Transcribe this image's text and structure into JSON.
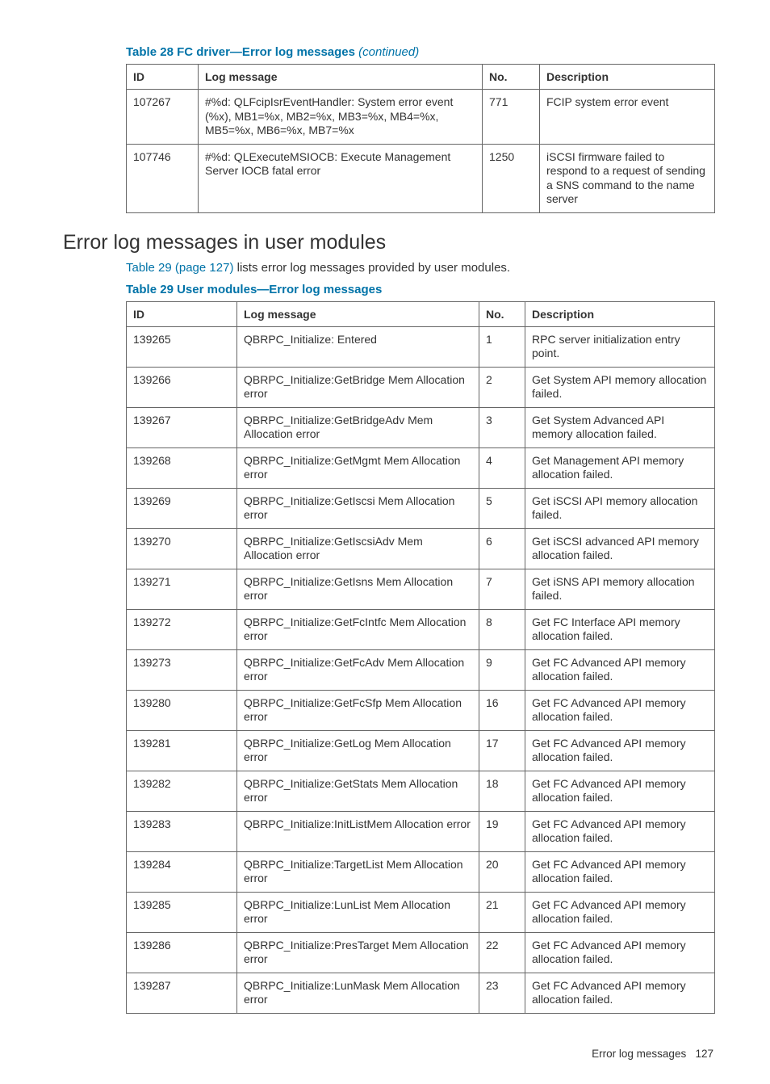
{
  "table28": {
    "caption_prefix": "Table 28 FC driver—Error log messages",
    "continued": "(continued)",
    "headers": {
      "id": "ID",
      "msg": "Log message",
      "no": "No.",
      "desc": "Description"
    },
    "rows": [
      {
        "id": "107267",
        "msg": "#%d: QLFcipIsrEventHandler: System error event (%x), MB1=%x, MB2=%x, MB3=%x, MB4=%x, MB5=%x, MB6=%x, MB7=%x",
        "no": "771",
        "desc": "FCIP system error event"
      },
      {
        "id": "107746",
        "msg": "#%d: QLExecuteMSIOCB: Execute Management Server IOCB fatal error",
        "no": "1250",
        "desc": "iSCSI firmware failed to respond to a request of sending a SNS command to the name server"
      }
    ]
  },
  "section_heading": "Error log messages in user modules",
  "body_link": "Table 29 (page 127)",
  "body_rest": " lists error log messages provided by user modules.",
  "table29": {
    "caption": "Table 29 User modules—Error log messages",
    "headers": {
      "id": "ID",
      "msg": "Log message",
      "no": "No.",
      "desc": "Description"
    },
    "rows": [
      {
        "id": "139265",
        "msg": "QBRPC_Initialize: Entered",
        "no": "1",
        "desc": "RPC server initialization entry point."
      },
      {
        "id": "139266",
        "msg": "QBRPC_Initialize:GetBridge Mem Allocation error",
        "no": "2",
        "desc": "Get System API memory allocation failed."
      },
      {
        "id": "139267",
        "msg": "QBRPC_Initialize:GetBridgeAdv Mem Allocation error",
        "no": "3",
        "desc": "Get System Advanced API memory allocation failed."
      },
      {
        "id": "139268",
        "msg": "QBRPC_Initialize:GetMgmt Mem Allocation error",
        "no": "4",
        "desc": "Get Management API memory allocation failed."
      },
      {
        "id": "139269",
        "msg": "QBRPC_Initialize:GetIscsi Mem Allocation error",
        "no": "5",
        "desc": "Get iSCSI API memory allocation failed."
      },
      {
        "id": "139270",
        "msg": "QBRPC_Initialize:GetIscsiAdv Mem Allocation error",
        "no": "6",
        "desc": "Get iSCSI advanced API memory allocation failed."
      },
      {
        "id": "139271",
        "msg": "QBRPC_Initialize:GetIsns Mem Allocation error",
        "no": "7",
        "desc": "Get iSNS API memory allocation failed."
      },
      {
        "id": "139272",
        "msg": "QBRPC_Initialize:GetFcIntfc Mem Allocation error",
        "no": "8",
        "desc": "Get FC Interface API memory allocation failed."
      },
      {
        "id": "139273",
        "msg": "QBRPC_Initialize:GetFcAdv Mem Allocation error",
        "no": "9",
        "desc": "Get FC Advanced API memory allocation failed."
      },
      {
        "id": "139280",
        "msg": "QBRPC_Initialize:GetFcSfp Mem Allocation error",
        "no": "16",
        "desc": "Get FC Advanced API memory allocation failed."
      },
      {
        "id": "139281",
        "msg": "QBRPC_Initialize:GetLog Mem Allocation error",
        "no": "17",
        "desc": "Get FC Advanced API memory allocation failed."
      },
      {
        "id": "139282",
        "msg": "QBRPC_Initialize:GetStats Mem Allocation error",
        "no": "18",
        "desc": "Get FC Advanced API memory allocation failed."
      },
      {
        "id": "139283",
        "msg": "QBRPC_Initialize:InitListMem Allocation error",
        "no": "19",
        "desc": "Get FC Advanced API memory allocation failed."
      },
      {
        "id": "139284",
        "msg": "QBRPC_Initialize:TargetList Mem Allocation error",
        "no": "20",
        "desc": "Get FC Advanced API memory allocation failed."
      },
      {
        "id": "139285",
        "msg": "QBRPC_Initialize:LunList Mem Allocation error",
        "no": "21",
        "desc": "Get FC Advanced API memory allocation failed."
      },
      {
        "id": "139286",
        "msg": "QBRPC_Initialize:PresTarget Mem Allocation error",
        "no": "22",
        "desc": "Get FC Advanced API memory allocation failed."
      },
      {
        "id": "139287",
        "msg": "QBRPC_Initialize:LunMask Mem Allocation error",
        "no": "23",
        "desc": "Get FC Advanced API memory allocation failed."
      }
    ]
  },
  "footer": {
    "label": "Error log messages",
    "page": "127"
  }
}
